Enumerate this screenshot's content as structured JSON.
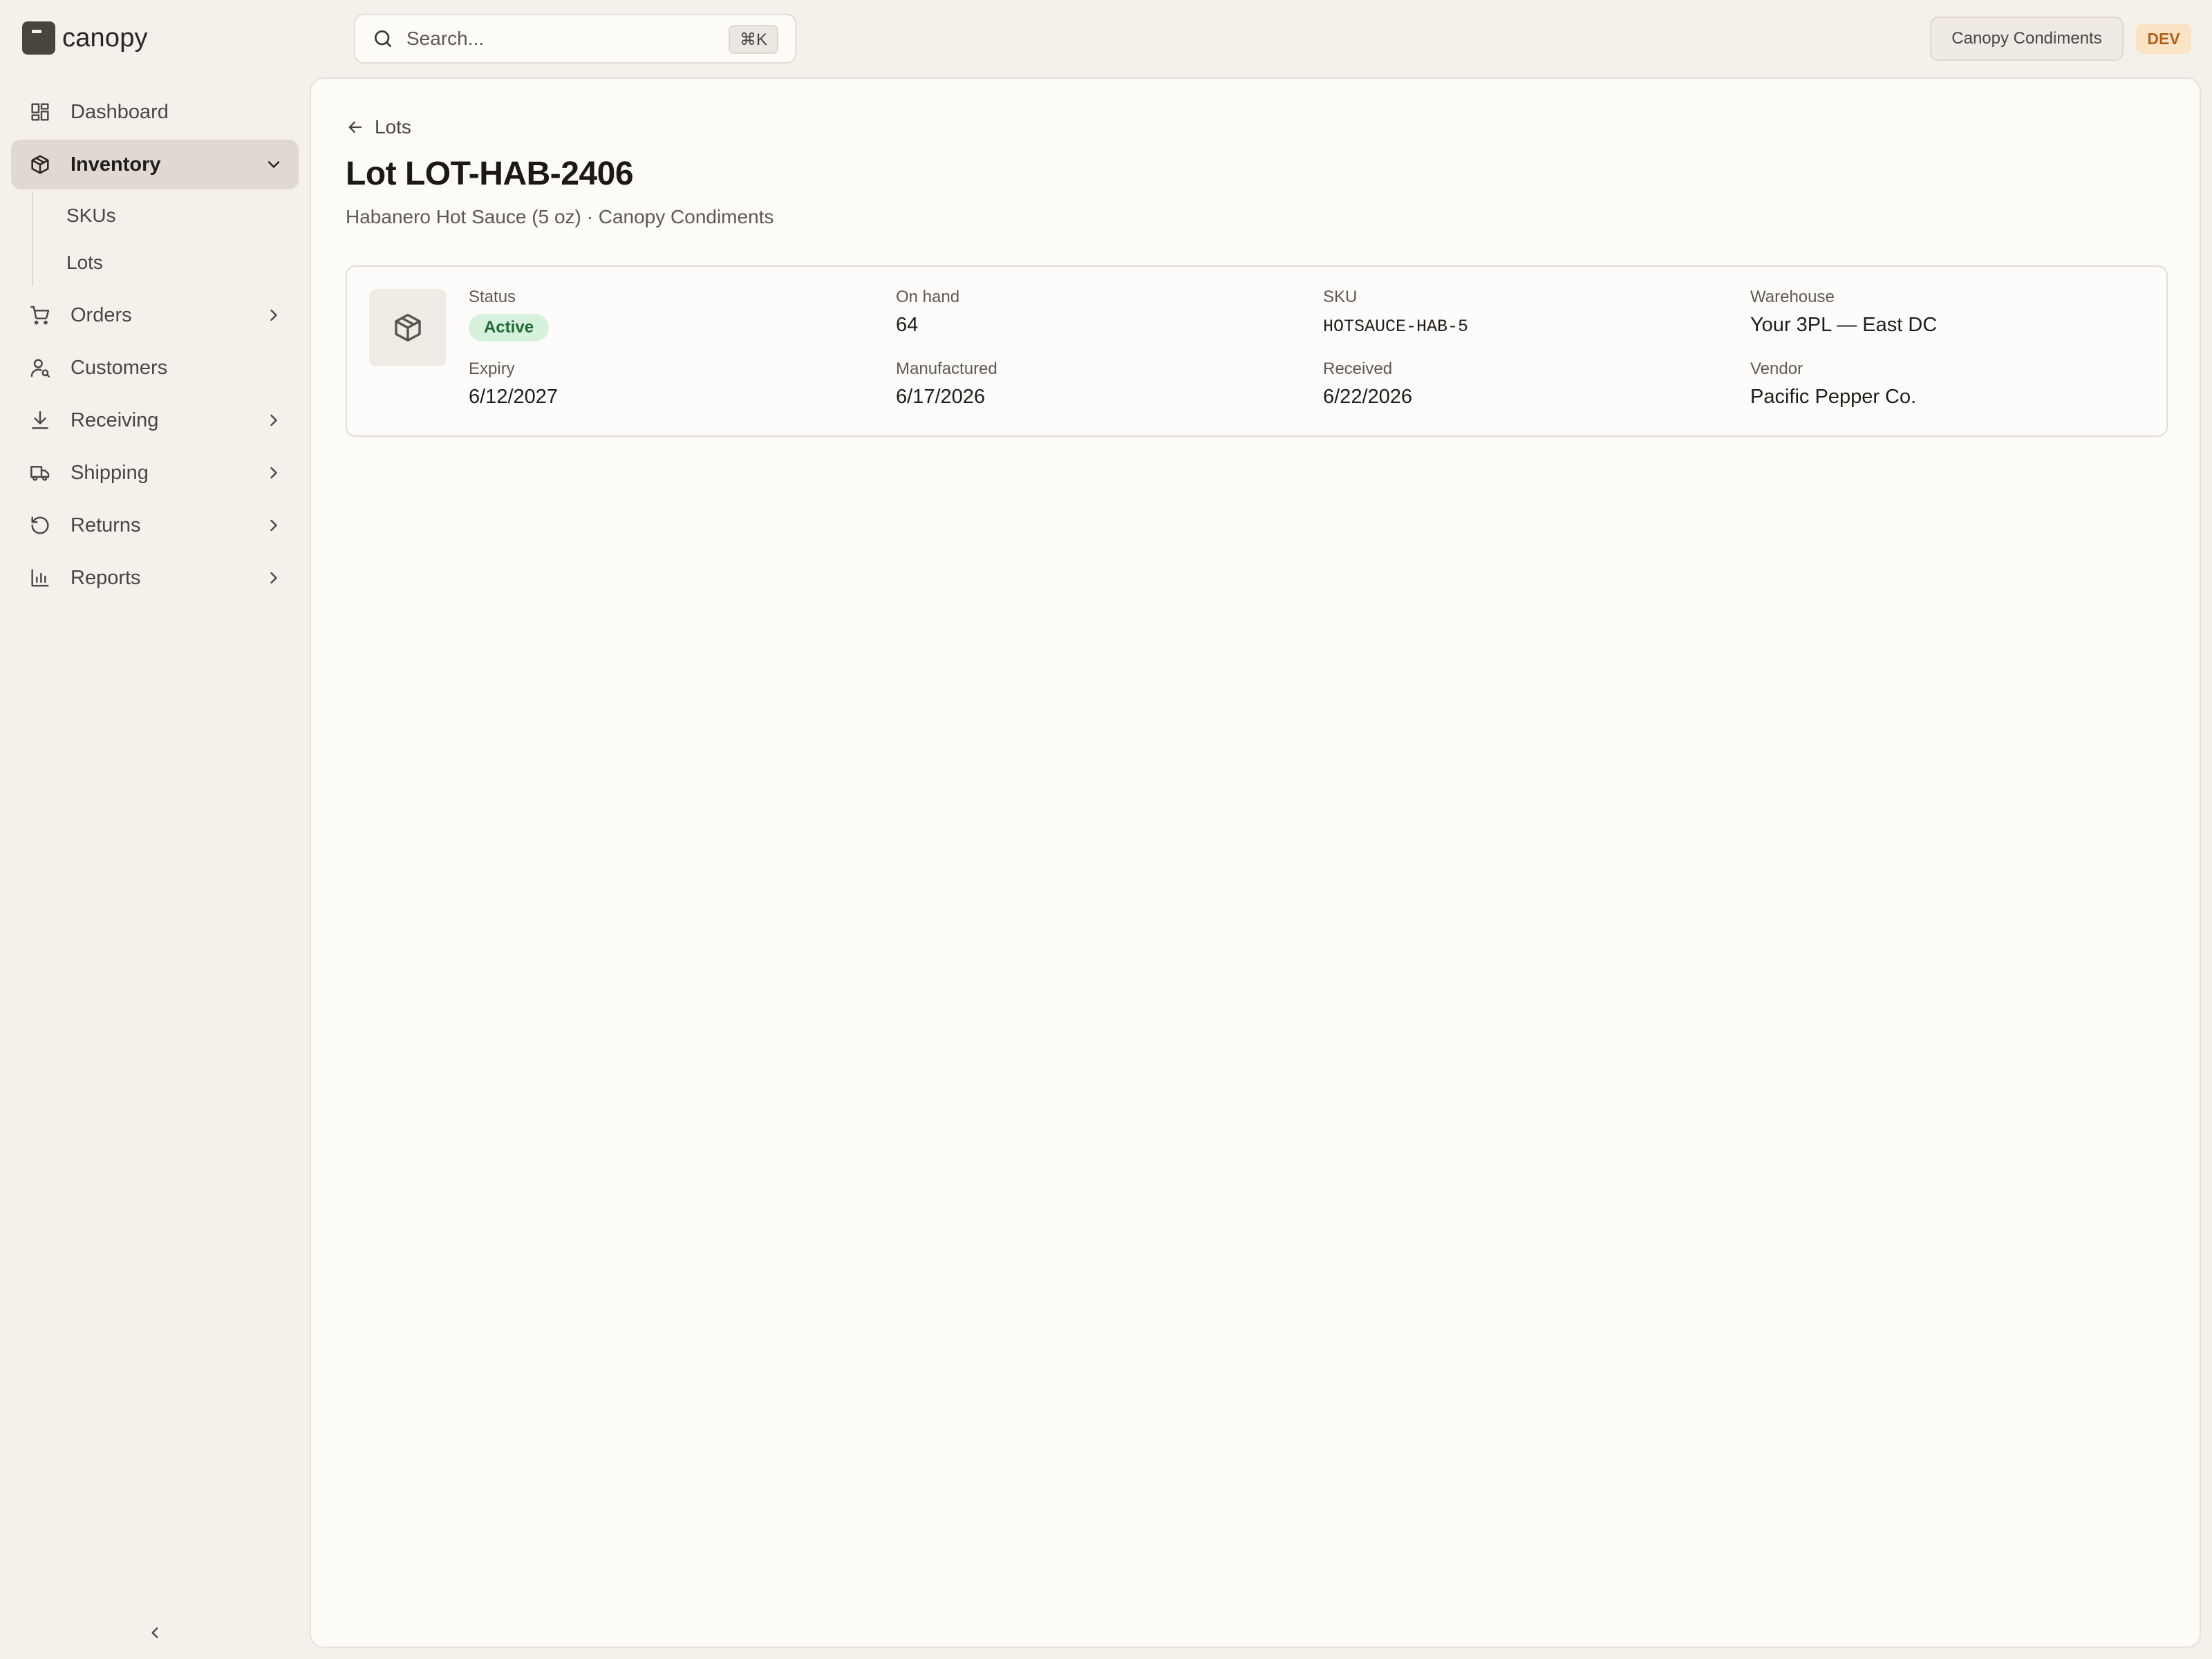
{
  "app": {
    "name": "canopy"
  },
  "search": {
    "placeholder": "Search...",
    "shortcut": "⌘K"
  },
  "header": {
    "org_name": "Canopy Condiments",
    "env_badge": "DEV"
  },
  "sidebar": {
    "items": [
      {
        "label": "Dashboard",
        "icon": "dashboard-icon"
      },
      {
        "label": "Inventory",
        "icon": "box-icon",
        "expanded": true,
        "active": true,
        "children": [
          {
            "label": "SKUs"
          },
          {
            "label": "Lots"
          }
        ]
      },
      {
        "label": "Orders",
        "icon": "cart-icon",
        "has_children": true
      },
      {
        "label": "Customers",
        "icon": "user-search-icon"
      },
      {
        "label": "Receiving",
        "icon": "download-icon",
        "has_children": true
      },
      {
        "label": "Shipping",
        "icon": "truck-icon",
        "has_children": true
      },
      {
        "label": "Returns",
        "icon": "rotate-ccw-icon",
        "has_children": true
      },
      {
        "label": "Reports",
        "icon": "bar-chart-icon",
        "has_children": true
      }
    ]
  },
  "page": {
    "back_label": "Lots",
    "title": "Lot LOT-HAB-2406",
    "subtitle": "Habanero Hot Sauce (5 oz) · Canopy Condiments"
  },
  "lot": {
    "status": {
      "label": "Status",
      "value": "Active"
    },
    "on_hand": {
      "label": "On hand",
      "value": "64"
    },
    "sku": {
      "label": "SKU",
      "value": "HOTSAUCE-HAB-5"
    },
    "warehouse": {
      "label": "Warehouse",
      "value": "Your 3PL — East DC"
    },
    "expiry": {
      "label": "Expiry",
      "value": "6/12/2027"
    },
    "manufactured": {
      "label": "Manufactured",
      "value": "6/17/2026"
    },
    "received": {
      "label": "Received",
      "value": "6/22/2026"
    },
    "vendor": {
      "label": "Vendor",
      "value": "Pacific Pepper Co."
    }
  },
  "colors": {
    "background": "#f4f0ea",
    "panel": "#fcfbf8",
    "active_nav": "#dfd9d1",
    "status_active_bg": "#d6f1de",
    "status_active_text": "#1f6a34",
    "env_badge_bg": "#fbe3c6",
    "env_badge_text": "#b5611a"
  }
}
